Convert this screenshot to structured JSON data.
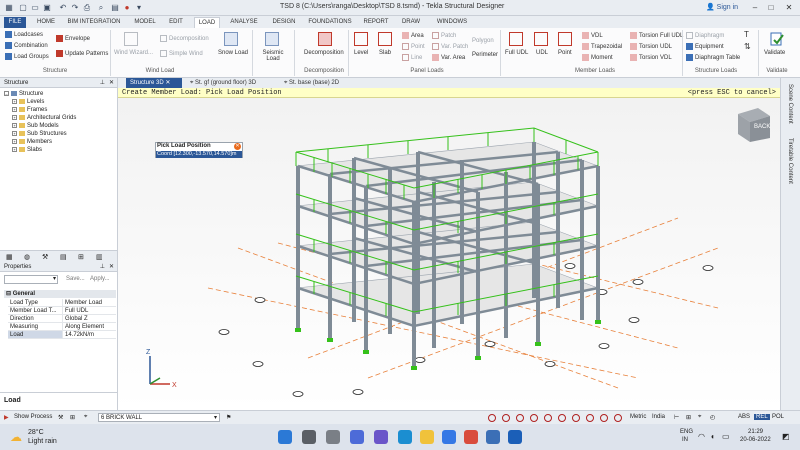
{
  "window": {
    "title": "TSD 8 (C:\\Users\\ranga\\Desktop\\TSD 8.tsmd) - Tekla Structural Designer",
    "sign_in": "Sign in"
  },
  "menu": {
    "tabs": [
      "FILE",
      "HOME",
      "BIM INTEGRATION",
      "MODEL",
      "EDIT",
      "LOAD",
      "ANALYSE",
      "DESIGN",
      "FOUNDATIONS",
      "REPORT",
      "DRAW",
      "WINDOWS"
    ],
    "active": "LOAD"
  },
  "ribbon": {
    "structure": {
      "loadcases": "Loadcases",
      "combination": "Combination",
      "load_groups": "Load Groups",
      "envelope": "Envelope",
      "update_patterns": "Update Patterns",
      "group": "Structure"
    },
    "wind": {
      "wind_wizard": "Wind Wizard...",
      "decomposition": "Decomposition",
      "simple_wind": "Simple Wind",
      "snow_load": "Snow Load",
      "group": "Wind Load"
    },
    "seismic": {
      "seismic_load": "Seismic Load"
    },
    "decomposition": {
      "label": "Decomposition",
      "group": "Decomposition"
    },
    "panel": {
      "level": "Level",
      "slab": "Slab",
      "area": "Area",
      "point": "Point",
      "line": "Line",
      "patch": "Patch",
      "var_patch": "Var. Patch",
      "var_area": "Var. Area",
      "polygon": "Polygon",
      "perimeter": "Perimeter",
      "group": "Panel Loads"
    },
    "member": {
      "full_udl": "Full UDL",
      "udl": "UDL",
      "point": "Point",
      "vdl": "VDL",
      "trapezoidal": "Trapezoidal",
      "moment": "Moment",
      "torsion_full_udl": "Torsion Full UDL",
      "torsion_udl": "Torsion UDL",
      "torsion_vdl": "Torsion VDL",
      "group": "Member Loads"
    },
    "structure_loads": {
      "diaphragm": "Diaphragm",
      "equipment": "Equipment",
      "diaphragm_table": "Diaphragm Table",
      "group": "Structure Loads"
    },
    "validate": {
      "label": "Validate",
      "group": "Validate"
    }
  },
  "structure_panel": {
    "title": "Structure",
    "tree": [
      "Structure",
      "Levels",
      "Frames",
      "Architectural Grids",
      "Sub Models",
      "Sub Structures",
      "Members",
      "Slabs"
    ]
  },
  "properties": {
    "title": "Properties",
    "save": "Save...",
    "apply": "Apply...",
    "section": "General",
    "rows": [
      {
        "key": "Load Type",
        "value": "Member Load"
      },
      {
        "key": "Member Load T...",
        "value": "Full UDL"
      },
      {
        "key": "Direction",
        "value": "Global Z"
      },
      {
        "key": "Measuring",
        "value": "Along Element"
      },
      {
        "key": "Load",
        "value": "14.72kN/m"
      }
    ]
  },
  "load_panel": {
    "title": "Load"
  },
  "view_tabs": [
    "Structure 3D",
    "St. gf (ground floor) 3D",
    "St. base (base) 2D"
  ],
  "prompt": {
    "left": "Create Member Load: Pick Load Position",
    "right": "<press ESC to cancel>"
  },
  "pick_dialog": {
    "title": "Pick Load Position",
    "value": "Coord [12.300,-13.570,14.570]m"
  },
  "viewcube": {
    "label": "BACK"
  },
  "right_strip": [
    "Scene Content",
    "Tiretable Content"
  ],
  "status": {
    "show_process": "Show Process",
    "wall_select": "6 BRICK WALL",
    "metric": "Metric",
    "country": "India",
    "abs": "ABS",
    "rel": "REL",
    "pol": "POL"
  },
  "taskbar": {
    "temp": "28°C",
    "weather": "Light rain",
    "lang1": "ENG",
    "lang2": "IN",
    "time": "21:29",
    "date": "20-06-2022"
  },
  "colors": {
    "accent": "#2b5797",
    "railing": "#35c11a",
    "steel": "#7f8b96",
    "prompt_bg": "#ffffc6"
  }
}
